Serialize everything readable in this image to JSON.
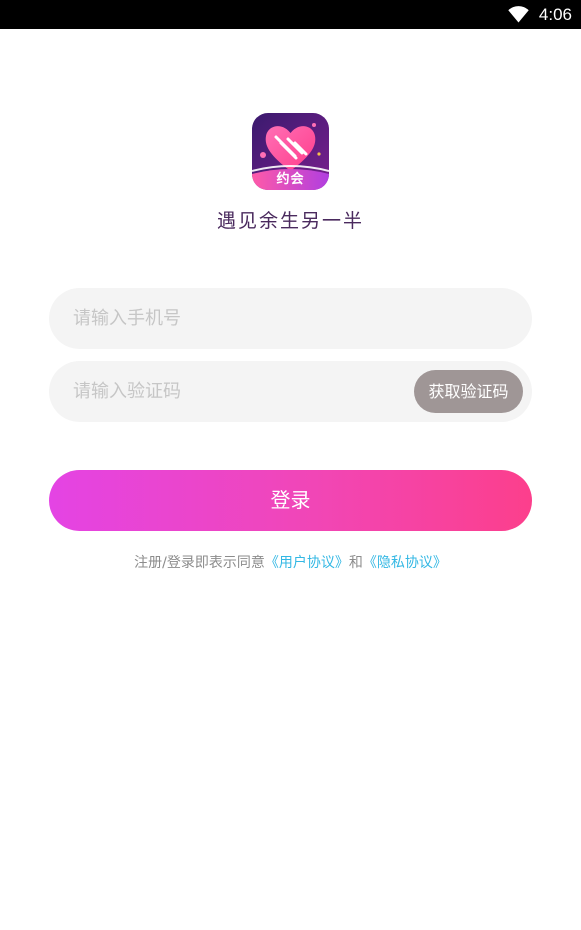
{
  "status_bar": {
    "time": "4:06",
    "wifi_icon": "wifi-icon"
  },
  "brand": {
    "logo_badge": "约会",
    "slogan": "遇见余生另一半"
  },
  "form": {
    "phone_placeholder": "请输入手机号",
    "phone_value": "",
    "code_placeholder": "请输入验证码",
    "code_value": "",
    "get_code_label": "获取验证码",
    "login_label": "登录"
  },
  "agreement": {
    "prefix": "注册/登录即表示同意",
    "user_agreement": "《用户协议》",
    "conjunction": "和",
    "privacy_policy": "《隐私协议》"
  },
  "colors": {
    "status_bar": "#000000",
    "login_gradient_start": "#e444e4",
    "login_gradient_end": "#fc3f8c",
    "get_code_button": "#9f9696",
    "link": "#34b8e4",
    "logo_background": "#5a1e8c",
    "logo_heart": "#ff4f9e"
  }
}
